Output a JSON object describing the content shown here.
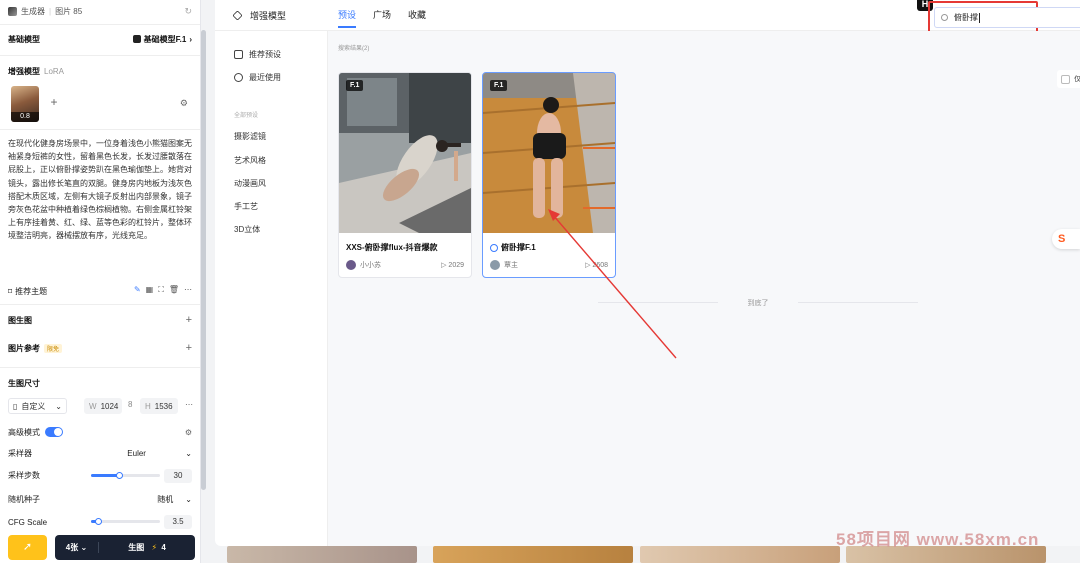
{
  "left_panel": {
    "header": {
      "title": "生成器",
      "sub": "图片 85"
    },
    "base_model": {
      "label": "基础模型",
      "value": "基础模型F.1",
      "chevron": "›"
    },
    "enhance_model": {
      "label": "增强模型",
      "tag": "LoRA",
      "lora_strength": "0.8"
    },
    "prompt": "在现代化健身房场景中，一位身着浅色小熊猫图案无袖紧身短裤的女性，留着黑色长发，长发过腰散落在屁股上，正以俯卧撑姿势趴在黑色瑜伽垫上。她背对镜头，露出修长笔直的双腿。健身房内地板为浅灰色搭配木质区域，左侧有大镜子反射出内部景象，镜子旁灰色花盆中种植着绿色棕榈植物。右侧金属杠铃架上有序挂着黄、红、绿、蓝等色彩的杠铃片，整体环境整洁明亮，器械摆放有序，光线充足。",
    "recommend_label": "推荐主题",
    "img2img_label": "图生图",
    "img_ref": {
      "label": "图片参考",
      "badge": "限免"
    },
    "size": {
      "label": "生图尺寸",
      "mode": "自定义",
      "w_label": "W",
      "w": "1024",
      "h_label": "H",
      "h": "1536"
    },
    "advanced": {
      "label": "高级模式",
      "on": true
    },
    "sampler": {
      "label": "采样器",
      "value": "Euler"
    },
    "steps": {
      "label": "采样步数",
      "value": "30",
      "fraction": 0.4
    },
    "seed": {
      "label": "随机种子",
      "value": "随机"
    },
    "cfg": {
      "label": "CFG Scale",
      "value": "3.5",
      "fraction": 0.1
    },
    "generate": {
      "count": "4张",
      "label": "生图",
      "cost": "4"
    }
  },
  "modal": {
    "title": "增强模型",
    "tabs": [
      {
        "label": "预设",
        "active": true
      },
      {
        "label": "广场",
        "active": false
      },
      {
        "label": "收藏",
        "active": false
      }
    ],
    "nav": {
      "top_items": [
        "推荐预设",
        "最近使用"
      ],
      "section_label": "全部预设",
      "categories": [
        "摄影滤镜",
        "艺术风格",
        "动漫画风",
        "手工艺",
        "3D立体"
      ]
    },
    "search": {
      "value": "俯卧撑",
      "badge": "H"
    },
    "result_count": "搜索结果(2)",
    "only_label": "仅",
    "cards": [
      {
        "tag": "F.1",
        "title": "XXS-俯卧撑flux-抖音爆款",
        "author": "小小苏",
        "uses": "2029",
        "selected": false,
        "video": false
      },
      {
        "tag": "F.1",
        "title": "俯卧撑F.1",
        "author": "覃主",
        "uses": "2608",
        "selected": true,
        "video": true
      }
    ],
    "end_text": "到底了"
  },
  "watermark": "58项目网 www.58xm.cn",
  "colors": {
    "accent": "#3a7bff",
    "highlight": "#e53935",
    "gen_button": "#1a2233",
    "gold": "#ffc21a"
  }
}
